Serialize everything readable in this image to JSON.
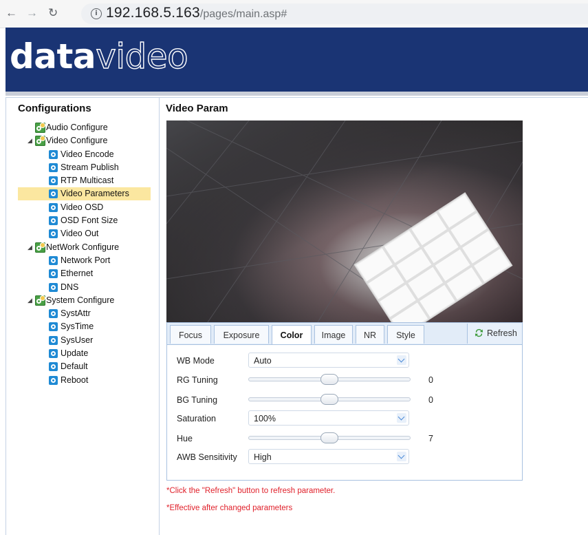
{
  "browser": {
    "url_host": "192.168.5.163",
    "url_path": "/pages/main.asp#"
  },
  "brand": {
    "logo_bold": "data",
    "logo_outline": "video"
  },
  "sidebar": {
    "title": "Configurations",
    "groups": [
      {
        "label": "Audio Configure",
        "expanded": false,
        "items": []
      },
      {
        "label": "Video Configure",
        "expanded": true,
        "items": [
          "Video Encode",
          "Stream Publish",
          "RTP Multicast",
          "Video Parameters",
          "Video OSD",
          "OSD Font Size",
          "Video Out"
        ]
      },
      {
        "label": "NetWork Configure",
        "expanded": true,
        "items": [
          "Network Port",
          "Ethernet",
          "DNS"
        ]
      },
      {
        "label": "System Configure",
        "expanded": true,
        "items": [
          "SystAttr",
          "SysTime",
          "SysUser",
          "Update",
          "Default",
          "Reboot"
        ]
      }
    ],
    "selected": "Video Parameters"
  },
  "content": {
    "title": "Video Param",
    "tabs": [
      "Focus",
      "Exposure",
      "Color",
      "Image",
      "NR",
      "Style"
    ],
    "active_tab": "Color",
    "refresh_label": "Refresh",
    "fields": {
      "wb_mode": {
        "label": "WB Mode",
        "value": "Auto"
      },
      "rg_tuning": {
        "label": "RG Tuning",
        "value": "0",
        "level": 0.5
      },
      "bg_tuning": {
        "label": "BG Tuning",
        "value": "0",
        "level": 0.5
      },
      "saturation": {
        "label": "Saturation",
        "value": "100%"
      },
      "hue": {
        "label": "Hue",
        "value": "7",
        "level": 0.5
      },
      "awb_sensitivity": {
        "label": "AWB Sensitivity",
        "value": "High"
      }
    },
    "notes": [
      "*Click the \"Refresh\" button to refresh parameter.",
      "*Effective after changed parameters"
    ]
  },
  "colors": {
    "banner": "#1a3474",
    "selection": "#fbe7a0",
    "note_red": "#e0202a",
    "tab_border": "#a8c1e0"
  }
}
